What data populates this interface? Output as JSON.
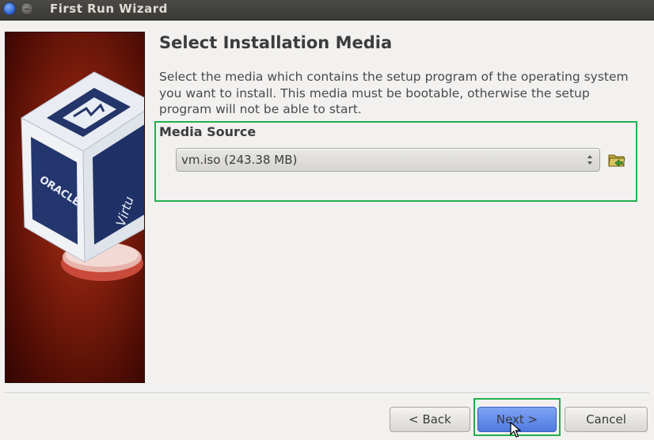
{
  "window": {
    "title": "First Run Wizard"
  },
  "page": {
    "heading": "Select Installation Media",
    "description": "Select the media which contains the setup program of the operating system you want to install. This media must be bootable, otherwise the setup program will not be able to start."
  },
  "media_source": {
    "label": "Media Source",
    "selected": "vm.iso (243.38 MB)"
  },
  "banner": {
    "cube_text_left": "ORACLE",
    "cube_text_right": "Virtu"
  },
  "buttons": {
    "back": "< Back",
    "next": "Next >",
    "cancel": "Cancel"
  },
  "colors": {
    "highlight": "#22b14c",
    "next_button": "#5b83e8",
    "banner": "#7e1d0c"
  },
  "icons": {
    "close": "close-icon",
    "minimize": "minimize-icon",
    "folder": "folder-icon",
    "cursor": "mouse-pointer-icon"
  }
}
